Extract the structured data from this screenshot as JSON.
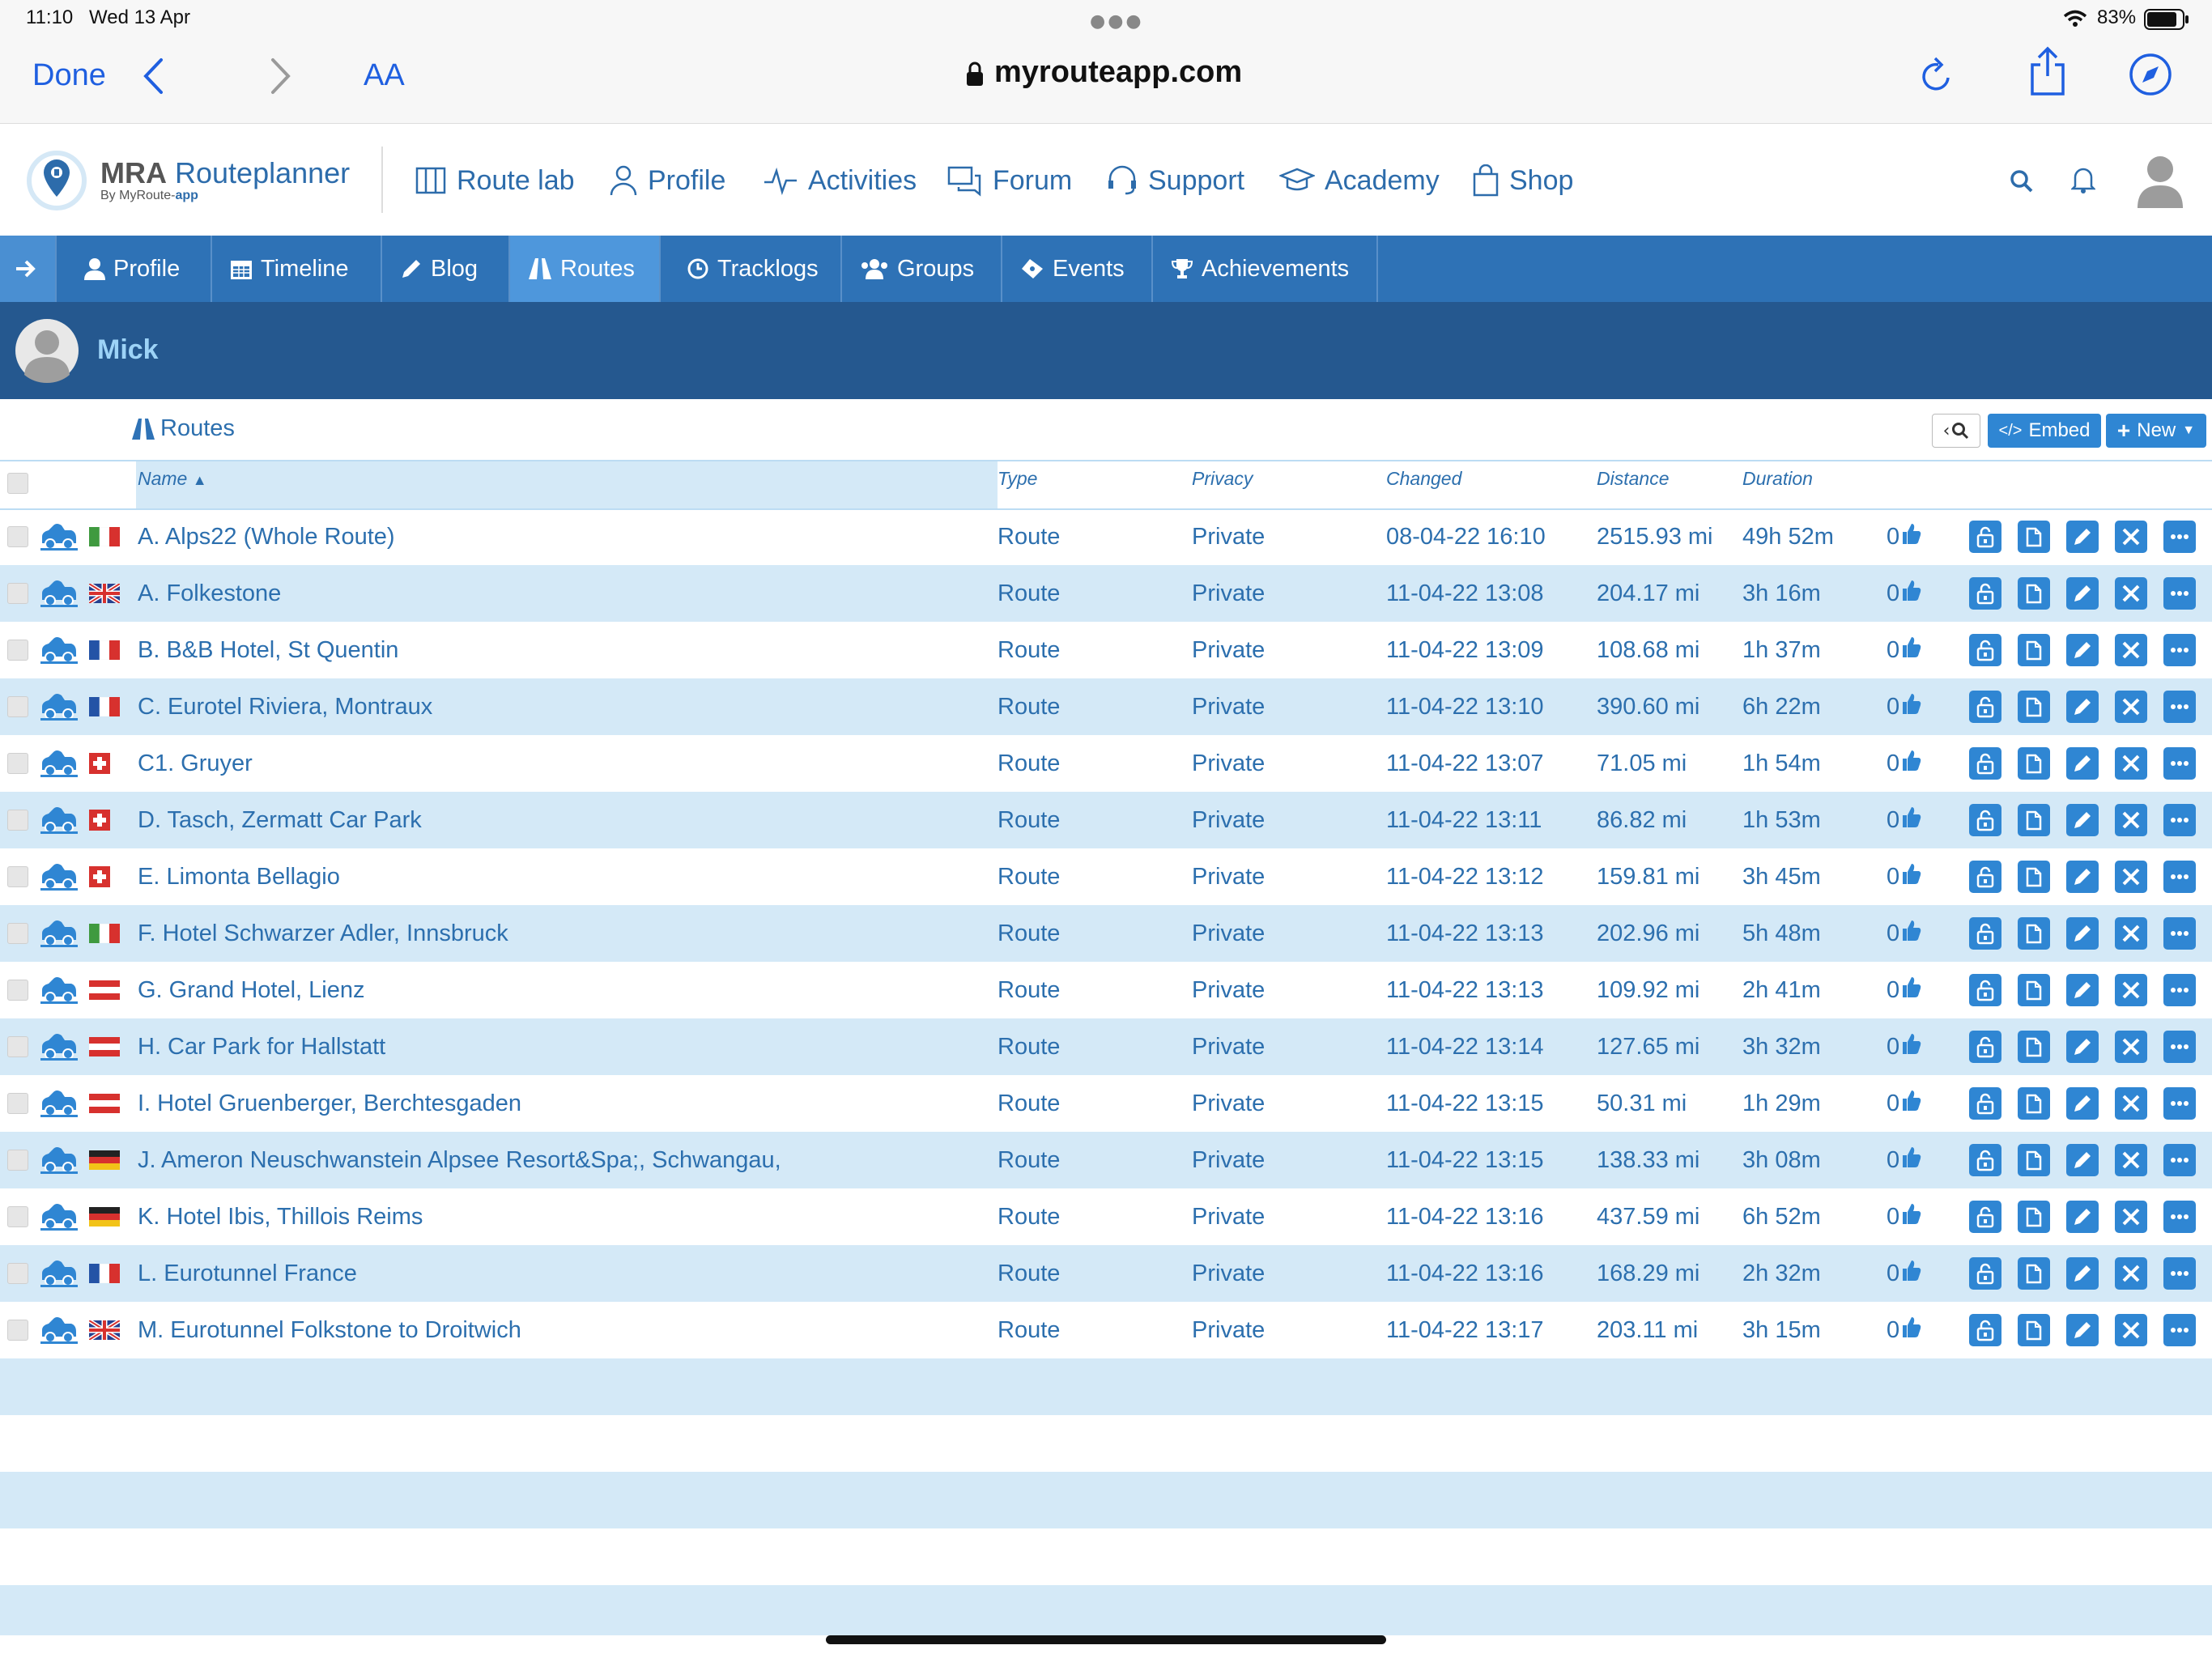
{
  "status": {
    "time": "11:10",
    "date": "Wed 13 Apr",
    "battery": "83%"
  },
  "safari": {
    "done": "Done",
    "aa": "AA",
    "url": "myrouteapp.com"
  },
  "brand": {
    "name_bold": "MRA",
    "name_rest": "Routeplanner",
    "sub_prefix": "By MyRoute-",
    "sub_bold": "app"
  },
  "nav": [
    "Route lab",
    "Profile",
    "Activities",
    "Forum",
    "Support",
    "Academy",
    "Shop"
  ],
  "tabs": [
    "Profile",
    "Timeline",
    "Blog",
    "Routes",
    "Tracklogs",
    "Groups",
    "Events",
    "Achievements"
  ],
  "active_tab": "Routes",
  "user": {
    "name": "Mick"
  },
  "routes_header": {
    "title": "Routes",
    "embed": "Embed",
    "new": "New"
  },
  "columns": {
    "name": "Name",
    "type": "Type",
    "privacy": "Privacy",
    "changed": "Changed",
    "distance": "Distance",
    "duration": "Duration"
  },
  "colors": {
    "accent": "#2e72b6",
    "active_tab": "#4e97dc",
    "user_strip": "#25588f",
    "row_alt": "#d4e9f7",
    "text": "#2c6fae"
  },
  "routes": [
    {
      "flag": "it",
      "name": "A. Alps22 (Whole Route)",
      "type": "Route",
      "privacy": "Private",
      "changed": "08-04-22 16:10",
      "distance": "2515.93 mi",
      "duration": "49h 52m",
      "likes": "0"
    },
    {
      "flag": "gb",
      "name": "A. Folkestone",
      "type": "Route",
      "privacy": "Private",
      "changed": "11-04-22 13:08",
      "distance": "204.17 mi",
      "duration": "3h 16m",
      "likes": "0"
    },
    {
      "flag": "fr",
      "name": "B. B&B Hotel, St Quentin",
      "type": "Route",
      "privacy": "Private",
      "changed": "11-04-22 13:09",
      "distance": "108.68 mi",
      "duration": "1h 37m",
      "likes": "0"
    },
    {
      "flag": "fr",
      "name": "C. Eurotel Riviera, Montraux",
      "type": "Route",
      "privacy": "Private",
      "changed": "11-04-22 13:10",
      "distance": "390.60 mi",
      "duration": "6h 22m",
      "likes": "0"
    },
    {
      "flag": "ch",
      "name": "C1. Gruyer",
      "type": "Route",
      "privacy": "Private",
      "changed": "11-04-22 13:07",
      "distance": "71.05 mi",
      "duration": "1h 54m",
      "likes": "0"
    },
    {
      "flag": "ch",
      "name": "D. Tasch, Zermatt Car Park",
      "type": "Route",
      "privacy": "Private",
      "changed": "11-04-22 13:11",
      "distance": "86.82 mi",
      "duration": "1h 53m",
      "likes": "0"
    },
    {
      "flag": "ch",
      "name": "E. Limonta Bellagio",
      "type": "Route",
      "privacy": "Private",
      "changed": "11-04-22 13:12",
      "distance": "159.81 mi",
      "duration": "3h 45m",
      "likes": "0"
    },
    {
      "flag": "it",
      "name": "F. Hotel Schwarzer Adler, Innsbruck",
      "type": "Route",
      "privacy": "Private",
      "changed": "11-04-22 13:13",
      "distance": "202.96 mi",
      "duration": "5h 48m",
      "likes": "0"
    },
    {
      "flag": "at",
      "name": "G. Grand Hotel, Lienz",
      "type": "Route",
      "privacy": "Private",
      "changed": "11-04-22 13:13",
      "distance": "109.92 mi",
      "duration": "2h 41m",
      "likes": "0"
    },
    {
      "flag": "at",
      "name": "H. Car Park for Hallstatt",
      "type": "Route",
      "privacy": "Private",
      "changed": "11-04-22 13:14",
      "distance": "127.65 mi",
      "duration": "3h 32m",
      "likes": "0"
    },
    {
      "flag": "at",
      "name": "I. Hotel Gruenberger, Berchtesgaden",
      "type": "Route",
      "privacy": "Private",
      "changed": "11-04-22 13:15",
      "distance": "50.31 mi",
      "duration": "1h 29m",
      "likes": "0"
    },
    {
      "flag": "de",
      "name": "J. Ameron Neuschwanstein Alpsee Resort&Spa;, Schwangau,",
      "type": "Route",
      "privacy": "Private",
      "changed": "11-04-22 13:15",
      "distance": "138.33 mi",
      "duration": "3h 08m",
      "likes": "0"
    },
    {
      "flag": "de",
      "name": "K. Hotel Ibis, Thillois Reims",
      "type": "Route",
      "privacy": "Private",
      "changed": "11-04-22 13:16",
      "distance": "437.59 mi",
      "duration": "6h 52m",
      "likes": "0"
    },
    {
      "flag": "fr",
      "name": "L. Eurotunnel France",
      "type": "Route",
      "privacy": "Private",
      "changed": "11-04-22 13:16",
      "distance": "168.29 mi",
      "duration": "2h 32m",
      "likes": "0"
    },
    {
      "flag": "gb",
      "name": "M. Eurotunnel Folkstone to Droitwich",
      "type": "Route",
      "privacy": "Private",
      "changed": "11-04-22 13:17",
      "distance": "203.11 mi",
      "duration": "3h 15m",
      "likes": "0"
    }
  ]
}
